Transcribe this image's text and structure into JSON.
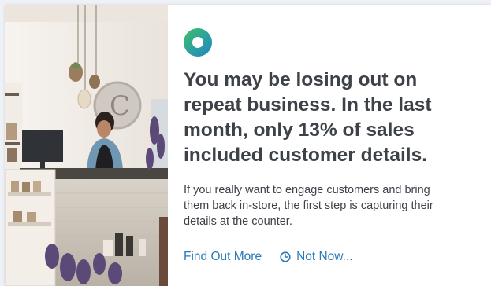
{
  "promo": {
    "headline": "You may be losing out on repeat business. In the last month, only 13% of sales included customer details.",
    "body": "If you really want to engage customers and bring them back in-store, the first step is capturing their details at the counter.",
    "primary_action": "Find Out More",
    "secondary_action": "Not Now...",
    "logo_icon": "ring-logo-icon",
    "clock_icon": "clock-icon"
  },
  "colors": {
    "heading": "#3d4148",
    "link": "#2a7ab9",
    "logo_green": "#3fbf6a",
    "logo_blue": "#1f86c8"
  }
}
